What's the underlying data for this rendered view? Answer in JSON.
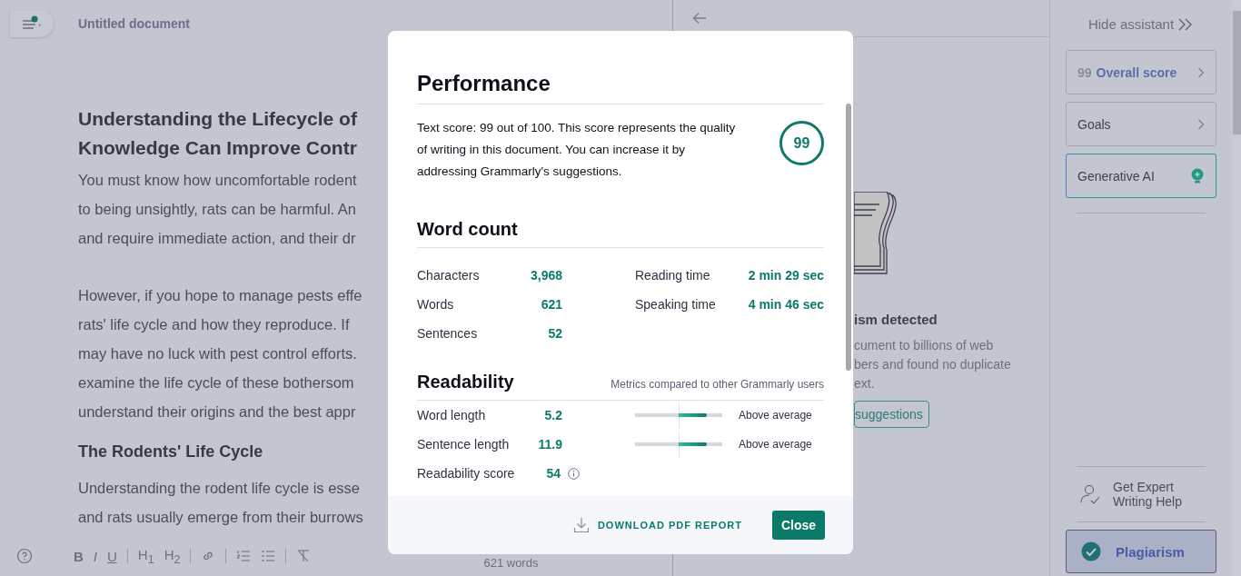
{
  "editor": {
    "document_title": "Untitled document",
    "heading_lines": [
      "Understanding the Lifecycle of",
      "Knowledge Can Improve Contr"
    ],
    "blocks": [
      {
        "kind": "paragraph",
        "lines": [
          "You must know how uncomfortable rodent",
          "to being unsightly, rats can be harmful. An",
          "and require immediate action, and their dr"
        ]
      },
      {
        "kind": "paragraph",
        "lines": [
          "However, if you hope to manage pests effe",
          "rats' life cycle and how they reproduce. If",
          "may have no luck with pest control efforts.",
          "examine the life cycle of these bothersom",
          "understand their origins and the best appr"
        ]
      },
      {
        "kind": "subheading",
        "lines": [
          "The Rodents' Life Cycle"
        ]
      },
      {
        "kind": "paragraph",
        "lines": [
          "Understanding the rodent life cycle is esse",
          "and rats usually emerge from their burrows"
        ]
      }
    ],
    "toolbar": [
      {
        "kind": "bold",
        "label": "B"
      },
      {
        "kind": "italic",
        "label": "I"
      },
      {
        "kind": "underline",
        "label": "U"
      },
      {
        "kind": "divider"
      },
      {
        "kind": "heading",
        "label": "H$_{1}$"
      },
      {
        "kind": "heading",
        "label": "H$_{2}$"
      },
      {
        "kind": "divider"
      },
      {
        "kind": "link"
      },
      {
        "kind": "divider"
      },
      {
        "kind": "ordered-list"
      },
      {
        "kind": "bullet-list"
      },
      {
        "kind": "divider"
      },
      {
        "kind": "clear-format"
      }
    ],
    "word_count": "621 words"
  },
  "plagiarism_panel": {
    "heading": "ism detected",
    "body_lines": [
      "cument to billions of web",
      "bers and found no duplicate",
      "ext."
    ],
    "button": "suggestions"
  },
  "sidebar": {
    "hide_label": "Hide assistant",
    "cards": [
      {
        "kind": "score",
        "score": "99",
        "label": "Overall score"
      },
      {
        "kind": "link",
        "label": "Goals"
      },
      {
        "kind": "ai",
        "label": "Generative AI"
      }
    ],
    "bottom": [
      {
        "kind": "expert",
        "label": "Get Expert Writing Help",
        "selected": false
      },
      {
        "kind": "check",
        "label": "Plagiarism",
        "selected": true
      }
    ]
  },
  "modal": {
    "title": "Performance",
    "score_text": "Text score: 99 out of 100. This score represents the quality of writing in this document. You can increase it by addressing Grammarly's suggestions.",
    "score": "99",
    "word_count": {
      "title": "Word count",
      "stats": [
        {
          "label": "Characters",
          "value": "3,968"
        },
        {
          "label": "Words",
          "value": "621"
        },
        {
          "label": "Sentences",
          "value": "52"
        }
      ],
      "times": [
        {
          "label": "Reading time",
          "value": "2 min 29 sec"
        },
        {
          "label": "Speaking time",
          "value": "4 min 46 sec"
        }
      ]
    },
    "readability": {
      "title": "Readability",
      "note": "Metrics compared to other Grammarly users",
      "metrics": [
        {
          "label": "Word length",
          "value": "5.2",
          "level": 0.82,
          "rating": "Above average"
        },
        {
          "label": "Sentence length",
          "value": "11.9",
          "level": 0.82,
          "rating": "Above average"
        }
      ],
      "score": {
        "label": "Readability score",
        "value": "54"
      }
    },
    "download": "DOWNLOAD PDF REPORT",
    "close": "Close"
  }
}
